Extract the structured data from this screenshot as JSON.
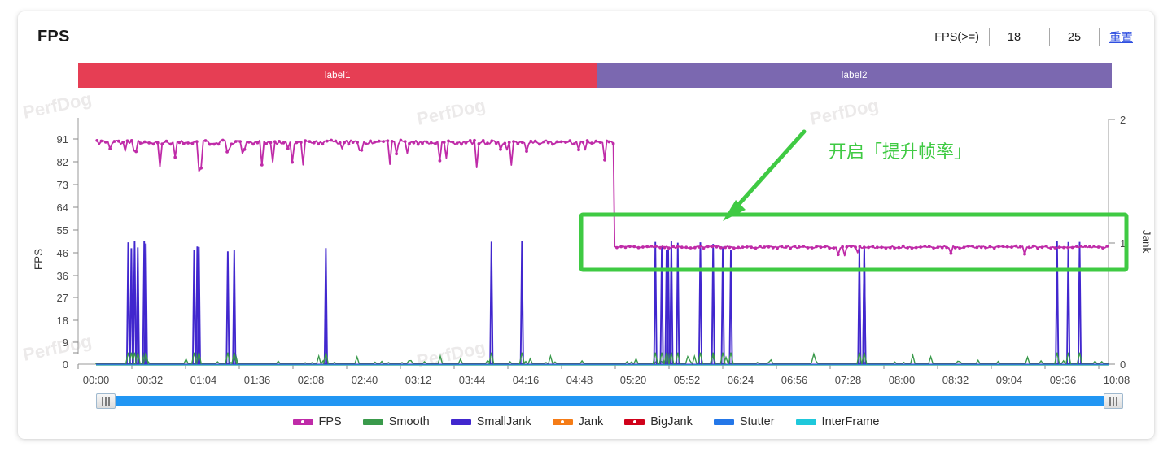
{
  "header": {
    "title": "FPS",
    "filter_label": "FPS(>=)",
    "threshold_low": "18",
    "threshold_high": "25",
    "reset_label": "重置"
  },
  "label_bars": [
    {
      "text": "label1",
      "color": "#E63E54",
      "width_pct": 50
    },
    {
      "text": "label2",
      "color": "#7B68B0",
      "width_pct": 50
    }
  ],
  "annotation": {
    "text": "开启「提升帧率」",
    "color": "#3FCA43",
    "highlight_color": "#3FCA43"
  },
  "watermark": {
    "text": "PerfDog",
    "color": "#ECEAEA"
  },
  "datazoom": {
    "start_pct": 0,
    "end_pct": 100
  },
  "legend": [
    {
      "label": "FPS",
      "color": "#BF2BA8",
      "marker": "line-dot"
    },
    {
      "label": "Smooth",
      "color": "#3A9A4B",
      "marker": "line"
    },
    {
      "label": "SmallJank",
      "color": "#4127CE",
      "marker": "line"
    },
    {
      "label": "Jank",
      "color": "#F57C17",
      "marker": "line-dot"
    },
    {
      "label": "BigJank",
      "color": "#D0021B",
      "marker": "line-dot"
    },
    {
      "label": "Stutter",
      "color": "#2477E8",
      "marker": "line"
    },
    {
      "label": "InterFrame",
      "color": "#1FC8DB",
      "marker": "line"
    }
  ],
  "chart_data": {
    "type": "line",
    "title": "FPS",
    "xlabel": "",
    "ylabel": "FPS",
    "y2label": "Jank",
    "grid": false,
    "legend_position": "bottom",
    "ylim": [
      0,
      95
    ],
    "y2lim": [
      0,
      2
    ],
    "yticks": [
      0,
      9,
      18,
      27,
      36,
      46,
      55,
      64,
      73,
      82,
      91
    ],
    "y2ticks": [
      0,
      1,
      2
    ],
    "xticks": [
      "00:00",
      "00:32",
      "01:04",
      "01:36",
      "02:08",
      "02:40",
      "03:12",
      "03:44",
      "04:16",
      "04:48",
      "05:20",
      "05:52",
      "06:24",
      "06:56",
      "07:28",
      "08:00",
      "08:32",
      "09:04",
      "09:36",
      "10:08"
    ],
    "x_range_seconds": [
      0,
      630
    ],
    "annotations": [
      {
        "text": "开启「提升帧率」",
        "x_time": "06:40",
        "y": 1.55,
        "color": "#3FCA43"
      },
      {
        "type": "arrow",
        "from_time": "07:20",
        "from_y": 1.85,
        "to_time": "06:05",
        "to_y": 1.05,
        "color": "#3FCA43"
      },
      {
        "type": "rect-highlight",
        "from_time": "05:18",
        "to_time": "10:30",
        "y_from": 0.72,
        "y_to": 1.28,
        "color": "#3FCA43"
      }
    ],
    "series": [
      {
        "name": "FPS",
        "color": "#BF2BA8",
        "axis": "left",
        "note": "~89-91 fps during label1 (00:00-05:22) with occasional dips to 78-86; drops to ~47 fps steady during label2 (05:22-10:30)",
        "segments": [
          {
            "from_time": "00:00",
            "to_time": "05:22",
            "mean": 90,
            "min": 78,
            "max": 91
          },
          {
            "from_time": "05:22",
            "to_time": "10:30",
            "mean": 47,
            "min": 44,
            "max": 49
          }
        ]
      },
      {
        "name": "Smooth",
        "color": "#3A9A4B",
        "axis": "right",
        "note": "low baseline near 0 with small bumps co-located with jank spikes"
      },
      {
        "name": "SmallJank",
        "color": "#4127CE",
        "axis": "right",
        "note": "narrow spikes reaching value 1",
        "spike_times": [
          "00:20",
          "00:24",
          "00:30",
          "01:01",
          "01:22",
          "04:06",
          "05:48",
          "05:56",
          "06:02",
          "06:16",
          "07:55"
        ]
      },
      {
        "name": "Jank",
        "color": "#F57C17",
        "axis": "right",
        "note": "flat near 0 across full range"
      },
      {
        "name": "BigJank",
        "color": "#D0021B",
        "axis": "right",
        "note": "flat at 0"
      },
      {
        "name": "Stutter",
        "color": "#2477E8",
        "axis": "right",
        "note": "flat at 0"
      },
      {
        "name": "InterFrame",
        "color": "#1FC8DB",
        "axis": "right",
        "note": "flat at 0"
      }
    ]
  }
}
